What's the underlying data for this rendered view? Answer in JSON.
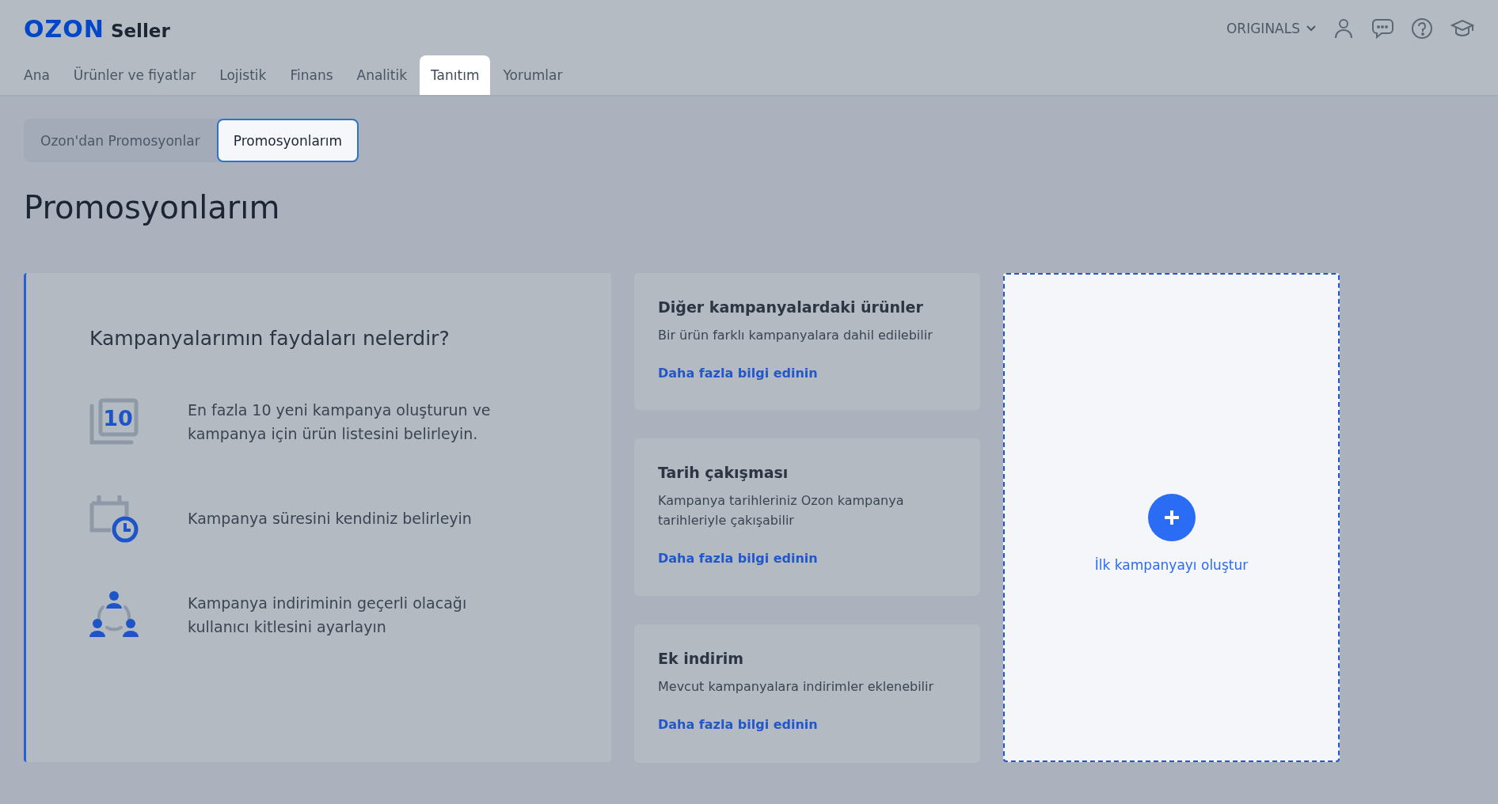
{
  "header": {
    "logo": "OZON",
    "logo_suffix": "Seller",
    "account": "ORIGINALS"
  },
  "nav": [
    {
      "label": "Ana",
      "selected": false
    },
    {
      "label": "Ürünler ve fiyatlar",
      "selected": false
    },
    {
      "label": "Lojistik",
      "selected": false
    },
    {
      "label": "Finans",
      "selected": false
    },
    {
      "label": "Analitik",
      "selected": false
    },
    {
      "label": "Tanıtım",
      "selected": true
    },
    {
      "label": "Yorumlar",
      "selected": false
    }
  ],
  "subtabs": [
    {
      "label": "Ozon'dan Promosyonlar",
      "selected": false
    },
    {
      "label": "Promosyonlarım",
      "selected": true
    }
  ],
  "page_title": "Promosyonlarım",
  "benefits": {
    "title": "Kampanyalarımın faydaları nelerdir?",
    "items": [
      {
        "kind": "count",
        "icon_text": "10",
        "text": "En fazla 10 yeni kampanya oluşturun ve kampanya için ürün listesini belirleyin."
      },
      {
        "kind": "schedule",
        "text": "Kampanya süresini kendiniz belirleyin"
      },
      {
        "kind": "audience",
        "text": "Kampanya indiriminin geçerli olacağı kullanıcı kitlesini ayarlayın"
      }
    ]
  },
  "info_cards": [
    {
      "title": "Diğer kampanyalardaki ürünler",
      "text": "Bir ürün farklı kampanyalara dahil edilebilir",
      "link": "Daha fazla bilgi edinin"
    },
    {
      "title": "Tarih çakışması",
      "text": "Kampanya tarihleriniz Ozon kampanya tarihleriyle çakışabilir",
      "link": "Daha fazla bilgi edinin"
    },
    {
      "title": "Ek indirim",
      "text": "Mevcut kampanyalara indirimler eklenebilir",
      "link": "Daha fazla bilgi edinin"
    }
  ],
  "create": {
    "label": "İlk kampanyayı oluştur"
  }
}
